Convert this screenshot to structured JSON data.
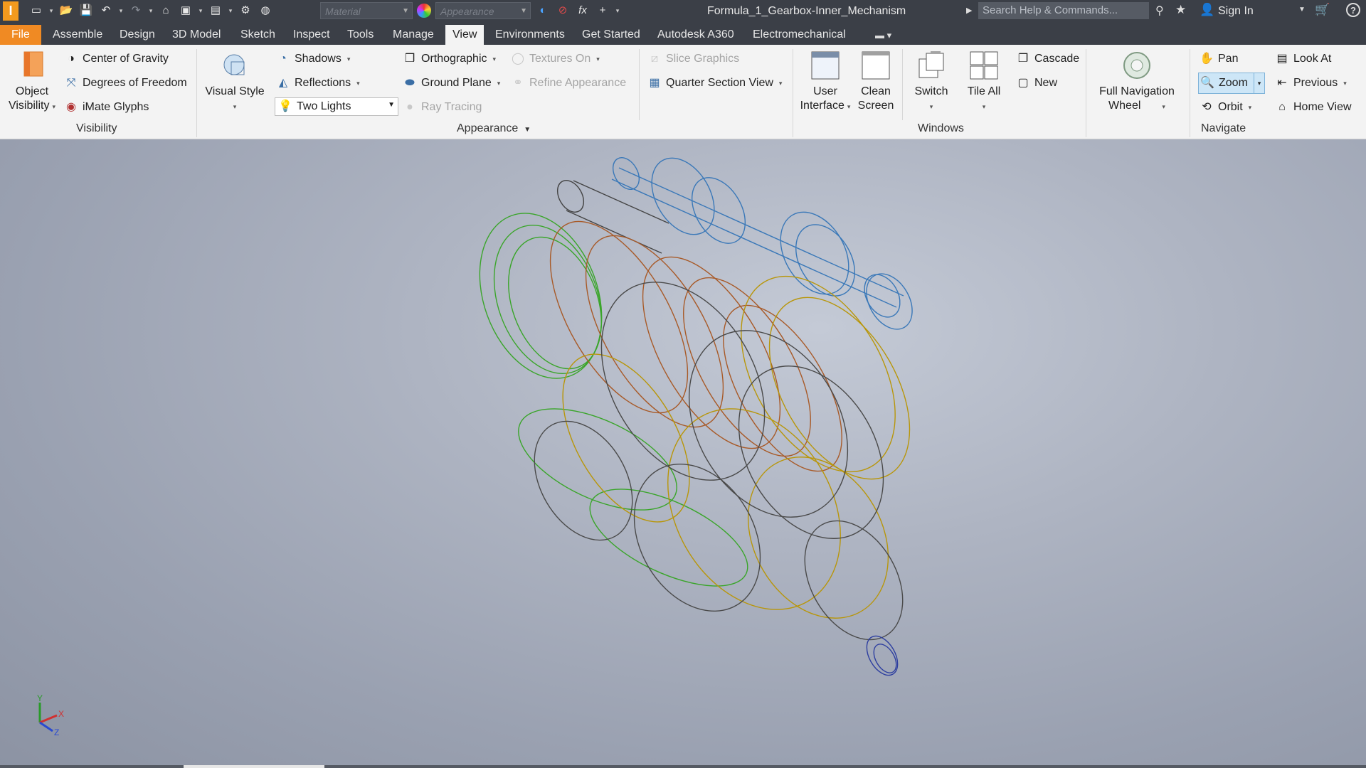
{
  "app": {
    "logo": "I",
    "document_title": "Formula_1_Gearbox-Inner_Mechanism"
  },
  "quick_access": {
    "material_placeholder": "Material",
    "appearance_placeholder": "Appearance",
    "search_placeholder": "Search Help & Commands...",
    "sign_in": "Sign In"
  },
  "tabs": [
    "File",
    "Assemble",
    "Design",
    "3D Model",
    "Sketch",
    "Inspect",
    "Tools",
    "Manage",
    "View",
    "Environments",
    "Get Started",
    "Autodesk A360",
    "Electromechanical"
  ],
  "active_tab": "View",
  "ribbon": {
    "visibility": {
      "label": "Visibility",
      "object_visibility": [
        "Object",
        "Visibility"
      ],
      "center_of_gravity": "Center of Gravity",
      "degrees_of_freedom": "Degrees of Freedom",
      "imate_glyphs": "iMate Glyphs"
    },
    "appearance": {
      "label": "Appearance",
      "visual_style": "Visual Style",
      "shadows": "Shadows",
      "reflections": "Reflections",
      "lighting": "Two Lights",
      "orthographic": "Orthographic",
      "ground_plane": "Ground Plane",
      "ray_tracing": "Ray Tracing",
      "textures_on": "Textures On",
      "refine_appearance": "Refine Appearance",
      "slice_graphics": "Slice Graphics",
      "quarter_section_view": "Quarter Section View"
    },
    "windows": {
      "label": "Windows",
      "user_interface": [
        "User",
        "Interface"
      ],
      "clean_screen": [
        "Clean",
        "Screen"
      ],
      "switch": "Switch",
      "tile_all": "Tile All",
      "cascade": "Cascade",
      "new": "New"
    },
    "navigate": {
      "label": "Navigate",
      "full_navigation_wheel": [
        "Full Navigation",
        "Wheel"
      ],
      "pan": "Pan",
      "zoom": "Zoom",
      "orbit": "Orbit",
      "look_at": "Look At",
      "previous": "Previous",
      "home_view": "Home View"
    }
  },
  "viewcube_axes": {
    "x": "X",
    "y": "Y",
    "z": "Z"
  },
  "colors": {
    "file_tab": "#f08a23",
    "titlebar": "#3b3f47",
    "ribbon": "#f3f3f3",
    "zoom_active": "#cde6f7"
  }
}
